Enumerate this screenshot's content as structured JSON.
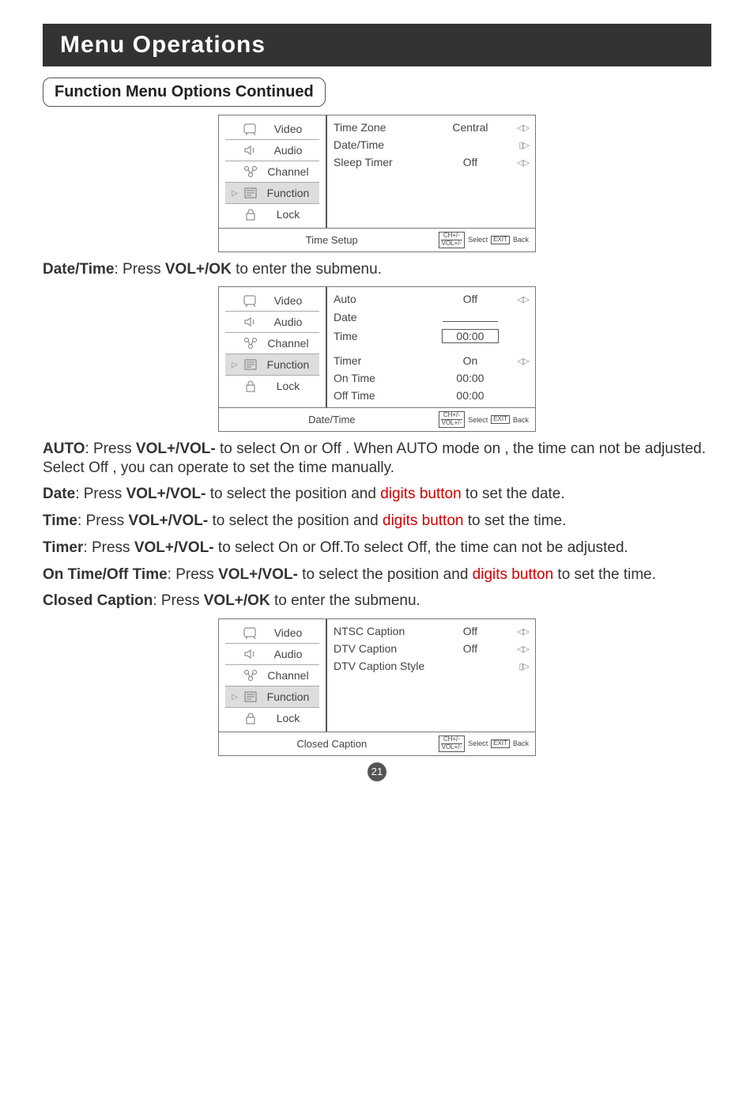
{
  "title_bar": "Menu Operations",
  "section_heading": "Function Menu Options Continued",
  "menu_labels": {
    "video": "Video",
    "audio": "Audio",
    "channel": "Channel",
    "function": "Function",
    "lock": "Lock"
  },
  "osd1": {
    "footer_title": "Time Setup",
    "rows": [
      {
        "label": "Time Zone",
        "value": "Central",
        "arrow": "◁▷"
      },
      {
        "label": "Date/Time",
        "value": "",
        "arrow": "▯▷"
      },
      {
        "label": "Sleep Timer",
        "value": "Off",
        "arrow": "◁▷"
      }
    ]
  },
  "osd2": {
    "footer_title": "Date/Time",
    "rows": [
      {
        "label": "Auto",
        "value": "Off",
        "arrow": "◁▷"
      },
      {
        "label": "Date",
        "value": "",
        "arrow": "",
        "slot": true
      },
      {
        "label": "Time",
        "value": "00:00",
        "arrow": "",
        "boxed": true
      },
      {
        "label": "Timer",
        "value": "On",
        "arrow": "◁▷"
      },
      {
        "label": "On Time",
        "value": "00:00",
        "arrow": ""
      },
      {
        "label": "Off Time",
        "value": "00:00",
        "arrow": ""
      }
    ]
  },
  "osd3": {
    "footer_title": "Closed Caption",
    "rows": [
      {
        "label": "NTSC Caption",
        "value": "Off",
        "arrow": "◁▷"
      },
      {
        "label": "DTV Caption",
        "value": "Off",
        "arrow": "◁▷"
      },
      {
        "label": "DTV Caption Style",
        "value": "",
        "arrow": "▯▷"
      }
    ]
  },
  "footer_hints": {
    "ch": "CH+/-",
    "vol": "VOL+/-",
    "select": "Select",
    "exit": "EXIT",
    "back": "Back"
  },
  "paragraphs": {
    "p1a": "Date/Time",
    "p1b": ": Press ",
    "p1c": "VOL+/OK",
    "p1d": " to enter the submenu.",
    "p2a": "AUTO",
    "p2b": ": Press ",
    "p2c": "VOL+/VOL-",
    "p2d": " to select On or Off . When AUTO mode on , the time can not be adjusted. Select Off , you can operate to set the time manually.",
    "p3a": "Date",
    "p3b": ": Press ",
    "p3c": "VOL+/VOL-",
    "p3d": " to select the position and ",
    "p3e": "digits button",
    "p3f": " to set the date.",
    "p4a": "Time",
    "p4b": ": Press ",
    "p4c": "VOL+/VOL-",
    "p4d": " to select the position and ",
    "p4e": "digits button",
    "p4f": " to set the time.",
    "p5a": "Timer",
    "p5b": ": Press ",
    "p5c": "VOL+/VOL-",
    "p5d": " to select On or Off.To select Off, the time can not be adjusted.",
    "p6a": "On Time/Off Time",
    "p6b": ": Press ",
    "p6c": "VOL+/VOL-",
    "p6d": " to select the position and ",
    "p6e": "digits button",
    "p6f": " to set the time.",
    "p7a": "Closed Caption",
    "p7b": ": Press ",
    "p7c": "VOL+/OK",
    "p7d": " to enter the submenu."
  },
  "page_number": "21"
}
